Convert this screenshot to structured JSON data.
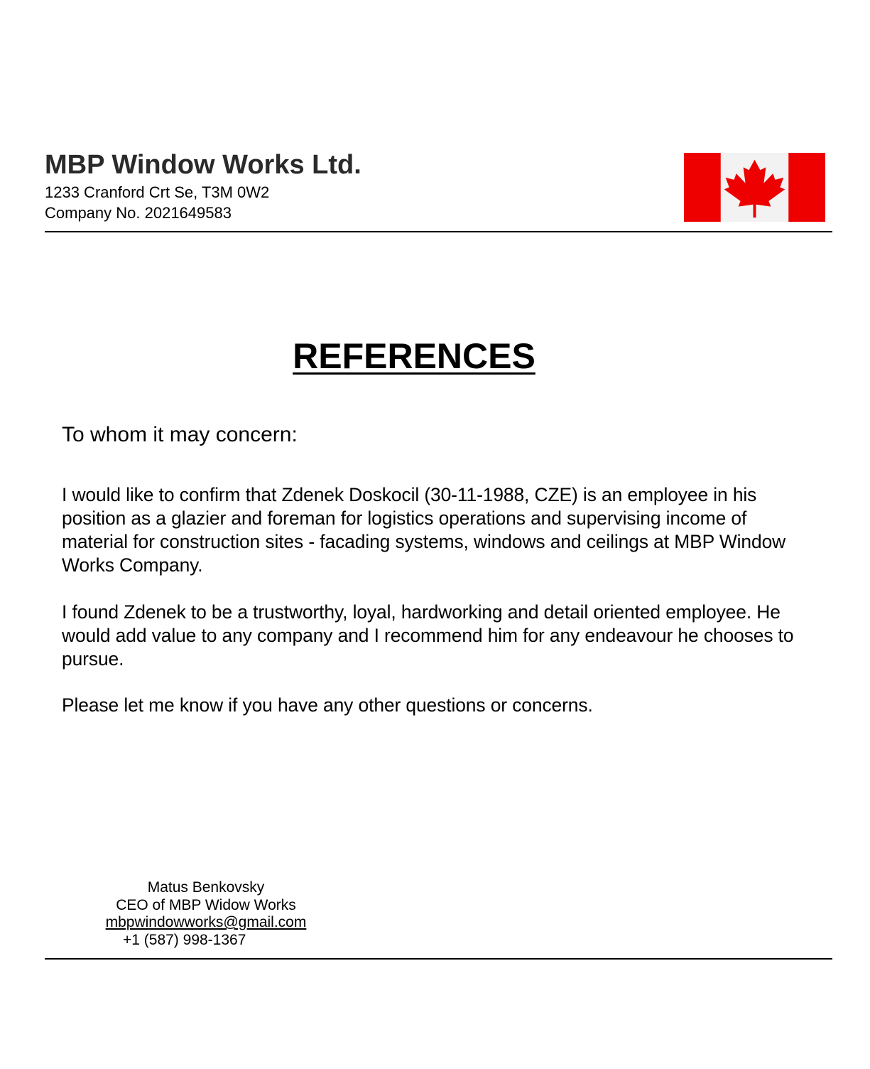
{
  "letterhead": {
    "company_name": "MBP Window Works Ltd.",
    "address": "1233 Cranford Crt Se, T3M 0W2",
    "company_no": "Company No. 2021649583",
    "flag": {
      "icon": "canada-flag-icon",
      "red": "#ee0000",
      "white": "#f2f2f2"
    }
  },
  "document": {
    "title": "REFERENCES",
    "salutation": "To whom it may concern:",
    "paragraphs": [
      "I would like to confirm that Zdenek Doskocil (30-11-1988, CZE) is an employee in his position as a glazier and foreman for logistics operations and supervising income of material for construction sites - facading systems, windows and ceilings at MBP Window Works Company.",
      "I found Zdenek to be a trustworthy, loyal, hardworking and detail oriented employee. He would add value to any company and I recommend him for any endeavour he chooses to pursue.",
      "Please let me know if you have any other questions or concerns."
    ]
  },
  "signature": {
    "name": "Matus Benkovsky",
    "role": "CEO of MBP Widow Works",
    "email": "mbpwindowworks@gmail.com",
    "phone": "+1 (587) 998-1367"
  }
}
